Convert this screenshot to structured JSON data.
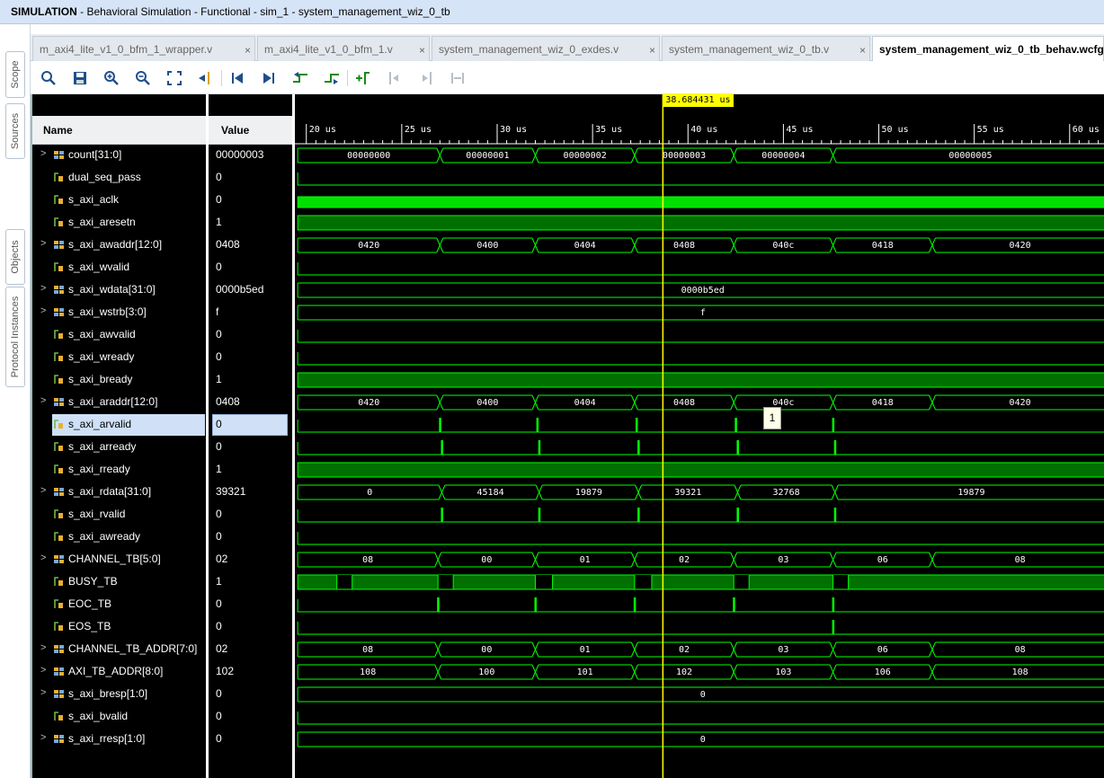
{
  "title": {
    "bold": "SIMULATION",
    "rest": " - Behavioral Simulation - Functional - sim_1 - system_management_wiz_0_tb"
  },
  "side_tabs": [
    "Scope",
    "Sources",
    "Objects",
    "Protocol Instances"
  ],
  "tabs": [
    {
      "label": "m_axi4_lite_v1_0_bfm_1_wrapper.v",
      "active": false
    },
    {
      "label": "m_axi4_lite_v1_0_bfm_1.v",
      "active": false
    },
    {
      "label": "system_management_wiz_0_exdes.v",
      "active": false
    },
    {
      "label": "system_management_wiz_0_tb.v",
      "active": false
    },
    {
      "label": "system_management_wiz_0_tb_behav.wcfg",
      "active": true
    }
  ],
  "close_glyph": "×",
  "toolbar_icons": [
    "search-icon",
    "save-icon",
    "zoom-in-icon",
    "zoom-out-icon",
    "zoom-fit-icon",
    "go-to-cursor-icon",
    "go-to-start-icon",
    "go-to-end-icon",
    "previous-transition-icon",
    "next-transition-icon",
    "add-marker-icon",
    "previous-marker-icon",
    "next-marker-icon",
    "swap-cursors-icon"
  ],
  "headers": {
    "name": "Name",
    "value": "Value"
  },
  "cursor": {
    "label": "38.684431 us",
    "time_us": 38.684431
  },
  "tooltip": "1",
  "timeline": {
    "start_us": 19.4,
    "end_us": 61.8,
    "ticks": [
      "20 us",
      "25 us",
      "30 us",
      "35 us",
      "40 us",
      "45 us",
      "50 us",
      "55 us",
      "60 us"
    ],
    "tick_values": [
      20,
      25,
      30,
      35,
      40,
      45,
      50,
      55,
      60
    ]
  },
  "colors": {
    "wave": "#00ff00",
    "bus_text": "#ffffff",
    "cursor": "#ffff00",
    "high_fill": "#007000",
    "clock_fill": "#00e000"
  },
  "signals": [
    {
      "name": "count[31:0]",
      "value": "00000003",
      "bus": true,
      "kind": "bus",
      "segments": [
        {
          "v": "00000000",
          "s": 19.5,
          "e": 27.0
        },
        {
          "v": "00000001",
          "s": 27.0,
          "e": 32.0
        },
        {
          "v": "00000002",
          "s": 32.0,
          "e": 37.2
        },
        {
          "v": "00000003",
          "s": 37.2,
          "e": 42.4
        },
        {
          "v": "00000004",
          "s": 42.4,
          "e": 47.6
        },
        {
          "v": "00000005",
          "s": 47.6,
          "e": 62
        }
      ]
    },
    {
      "name": "dual_seq_pass",
      "value": "0",
      "bus": false,
      "kind": "low"
    },
    {
      "name": "s_axi_aclk",
      "value": "0",
      "bus": false,
      "kind": "clock"
    },
    {
      "name": "s_axi_aresetn",
      "value": "1",
      "bus": false,
      "kind": "high"
    },
    {
      "name": "s_axi_awaddr[12:0]",
      "value": "0408",
      "bus": true,
      "kind": "bus",
      "segments": [
        {
          "v": "0420",
          "s": 19.5,
          "e": 27.0
        },
        {
          "v": "0400",
          "s": 27.0,
          "e": 32.0
        },
        {
          "v": "0404",
          "s": 32.0,
          "e": 37.2
        },
        {
          "v": "0408",
          "s": 37.2,
          "e": 42.4
        },
        {
          "v": "040c",
          "s": 42.4,
          "e": 47.6
        },
        {
          "v": "0418",
          "s": 47.6,
          "e": 52.8
        },
        {
          "v": "0420",
          "s": 52.8,
          "e": 62
        }
      ]
    },
    {
      "name": "s_axi_wvalid",
      "value": "0",
      "bus": false,
      "kind": "low"
    },
    {
      "name": "s_axi_wdata[31:0]",
      "value": "0000b5ed",
      "bus": true,
      "kind": "bus",
      "segments": [
        {
          "v": "0000b5ed",
          "s": 19.5,
          "e": 62
        }
      ]
    },
    {
      "name": "s_axi_wstrb[3:0]",
      "value": "f",
      "bus": true,
      "kind": "bus",
      "segments": [
        {
          "v": "f",
          "s": 19.5,
          "e": 62
        }
      ]
    },
    {
      "name": "s_axi_awvalid",
      "value": "0",
      "bus": false,
      "kind": "low"
    },
    {
      "name": "s_axi_wready",
      "value": "0",
      "bus": false,
      "kind": "low"
    },
    {
      "name": "s_axi_bready",
      "value": "1",
      "bus": false,
      "kind": "high"
    },
    {
      "name": "s_axi_araddr[12:0]",
      "value": "0408",
      "bus": true,
      "kind": "bus",
      "segments": [
        {
          "v": "0420",
          "s": 19.5,
          "e": 27.0
        },
        {
          "v": "0400",
          "s": 27.0,
          "e": 32.0
        },
        {
          "v": "0404",
          "s": 32.0,
          "e": 37.2
        },
        {
          "v": "0408",
          "s": 37.2,
          "e": 42.4
        },
        {
          "v": "040c",
          "s": 42.4,
          "e": 47.6
        },
        {
          "v": "0418",
          "s": 47.6,
          "e": 52.8
        },
        {
          "v": "0420",
          "s": 52.8,
          "e": 62
        }
      ]
    },
    {
      "name": "s_axi_arvalid",
      "value": "0",
      "bus": false,
      "kind": "pulse",
      "selected": true,
      "pulses": [
        27.0,
        32.1,
        37.3,
        42.5,
        47.6
      ]
    },
    {
      "name": "s_axi_arready",
      "value": "0",
      "bus": false,
      "kind": "pulse",
      "pulses": [
        27.1,
        32.2,
        37.4,
        42.6,
        47.7
      ]
    },
    {
      "name": "s_axi_rready",
      "value": "1",
      "bus": false,
      "kind": "high"
    },
    {
      "name": "s_axi_rdata[31:0]",
      "value": "39321",
      "bus": true,
      "kind": "bus",
      "segments": [
        {
          "v": "0",
          "s": 19.5,
          "e": 27.1
        },
        {
          "v": "45184",
          "s": 27.1,
          "e": 32.2
        },
        {
          "v": "19879",
          "s": 32.2,
          "e": 37.4
        },
        {
          "v": "39321",
          "s": 37.4,
          "e": 42.6
        },
        {
          "v": "32768",
          "s": 42.6,
          "e": 47.7
        },
        {
          "v": "19879",
          "s": 47.7,
          "e": 62
        }
      ]
    },
    {
      "name": "s_axi_rvalid",
      "value": "0",
      "bus": false,
      "kind": "pulse",
      "pulses": [
        27.1,
        32.2,
        37.4,
        42.6,
        47.7
      ]
    },
    {
      "name": "s_axi_awready",
      "value": "0",
      "bus": false,
      "kind": "low"
    },
    {
      "name": "CHANNEL_TB[5:0]",
      "value": "02",
      "bus": true,
      "kind": "bus",
      "segments": [
        {
          "v": "08",
          "s": 19.5,
          "e": 26.9
        },
        {
          "v": "00",
          "s": 26.9,
          "e": 32.0
        },
        {
          "v": "01",
          "s": 32.0,
          "e": 37.2
        },
        {
          "v": "02",
          "s": 37.2,
          "e": 42.4
        },
        {
          "v": "03",
          "s": 42.4,
          "e": 47.6
        },
        {
          "v": "06",
          "s": 47.6,
          "e": 52.8
        },
        {
          "v": "08",
          "s": 52.8,
          "e": 62
        }
      ]
    },
    {
      "name": "BUSY_TB",
      "value": "1",
      "bus": false,
      "kind": "busy",
      "lows": [
        [
          21.6,
          22.4
        ],
        [
          26.9,
          27.7
        ],
        [
          32.0,
          32.9
        ],
        [
          37.2,
          38.1
        ],
        [
          42.4,
          43.2
        ],
        [
          47.6,
          48.4
        ]
      ]
    },
    {
      "name": "EOC_TB",
      "value": "0",
      "bus": false,
      "kind": "pulse",
      "pulses": [
        26.9,
        32.0,
        37.2,
        42.4,
        47.6
      ]
    },
    {
      "name": "EOS_TB",
      "value": "0",
      "bus": false,
      "kind": "pulse",
      "pulses": [
        47.6
      ]
    },
    {
      "name": "CHANNEL_TB_ADDR[7:0]",
      "value": "02",
      "bus": true,
      "kind": "bus",
      "segments": [
        {
          "v": "08",
          "s": 19.5,
          "e": 26.9
        },
        {
          "v": "00",
          "s": 26.9,
          "e": 32.0
        },
        {
          "v": "01",
          "s": 32.0,
          "e": 37.2
        },
        {
          "v": "02",
          "s": 37.2,
          "e": 42.4
        },
        {
          "v": "03",
          "s": 42.4,
          "e": 47.6
        },
        {
          "v": "06",
          "s": 47.6,
          "e": 52.8
        },
        {
          "v": "08",
          "s": 52.8,
          "e": 62
        }
      ]
    },
    {
      "name": "AXI_TB_ADDR[8:0]",
      "value": "102",
      "bus": true,
      "kind": "bus",
      "segments": [
        {
          "v": "108",
          "s": 19.5,
          "e": 26.9
        },
        {
          "v": "100",
          "s": 26.9,
          "e": 32.0
        },
        {
          "v": "101",
          "s": 32.0,
          "e": 37.2
        },
        {
          "v": "102",
          "s": 37.2,
          "e": 42.4
        },
        {
          "v": "103",
          "s": 42.4,
          "e": 47.6
        },
        {
          "v": "106",
          "s": 47.6,
          "e": 52.8
        },
        {
          "v": "108",
          "s": 52.8,
          "e": 62
        }
      ]
    },
    {
      "name": "s_axi_bresp[1:0]",
      "value": "0",
      "bus": true,
      "kind": "bus",
      "segments": [
        {
          "v": "0",
          "s": 19.5,
          "e": 62
        }
      ]
    },
    {
      "name": "s_axi_bvalid",
      "value": "0",
      "bus": false,
      "kind": "low"
    },
    {
      "name": "s_axi_rresp[1:0]",
      "value": "0",
      "bus": true,
      "kind": "bus",
      "segments": [
        {
          "v": "0",
          "s": 19.5,
          "e": 62
        }
      ]
    }
  ]
}
